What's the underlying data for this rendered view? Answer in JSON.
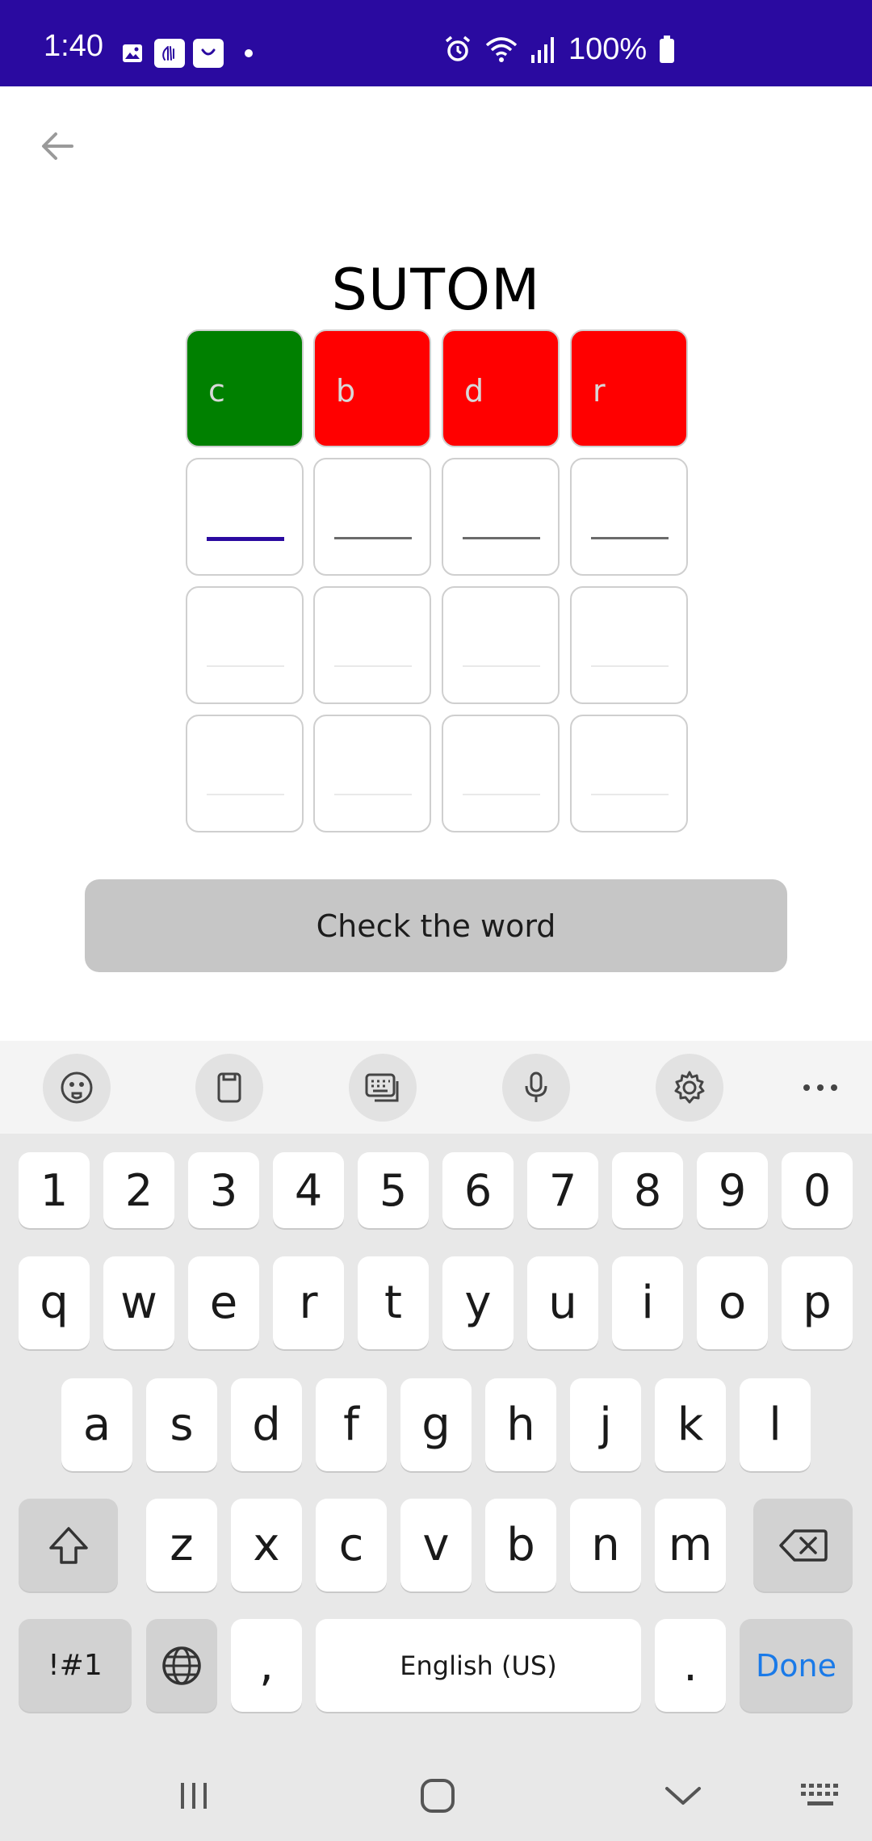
{
  "status_bar": {
    "time": "1:40",
    "battery_percent": "100%",
    "notification_icons": [
      "image-icon",
      "hand-icon",
      "bag-icon",
      "dot-icon"
    ],
    "system_icons": [
      "alarm-icon",
      "wifi-icon",
      "signal-icon",
      "battery-icon"
    ],
    "background": "#2a0aa0"
  },
  "app": {
    "title": "SUTOM",
    "back_icon": "arrow-left-icon",
    "check_button_label": "Check the word",
    "grid": {
      "rows": [
        [
          {
            "letter": "c",
            "state": "correct",
            "color": "#008000"
          },
          {
            "letter": "b",
            "state": "wrong",
            "color": "#ff0000"
          },
          {
            "letter": "d",
            "state": "wrong",
            "color": "#ff0000"
          },
          {
            "letter": "r",
            "state": "wrong",
            "color": "#ff0000"
          }
        ],
        [
          {
            "letter": "",
            "state": "active"
          },
          {
            "letter": "",
            "state": "editable"
          },
          {
            "letter": "",
            "state": "editable"
          },
          {
            "letter": "",
            "state": "editable"
          }
        ],
        [
          {
            "letter": "",
            "state": "disabled"
          },
          {
            "letter": "",
            "state": "disabled"
          },
          {
            "letter": "",
            "state": "disabled"
          },
          {
            "letter": "",
            "state": "disabled"
          }
        ],
        [
          {
            "letter": "",
            "state": "disabled"
          },
          {
            "letter": "",
            "state": "disabled"
          },
          {
            "letter": "",
            "state": "disabled"
          },
          {
            "letter": "",
            "state": "disabled"
          }
        ]
      ]
    }
  },
  "keyboard": {
    "toolbar": [
      "emoji-icon",
      "clipboard-icon",
      "keyboard-mode-icon",
      "microphone-icon",
      "settings-icon",
      "more-icon"
    ],
    "number_row": [
      "1",
      "2",
      "3",
      "4",
      "5",
      "6",
      "7",
      "8",
      "9",
      "0"
    ],
    "row1": [
      "q",
      "w",
      "e",
      "r",
      "t",
      "y",
      "u",
      "i",
      "o",
      "p"
    ],
    "row2": [
      "a",
      "s",
      "d",
      "f",
      "g",
      "h",
      "j",
      "k",
      "l"
    ],
    "row3": [
      "z",
      "x",
      "c",
      "v",
      "b",
      "n",
      "m"
    ],
    "symbols_label": "!#1",
    "comma_label": ",",
    "space_label": "English (US)",
    "period_label": ".",
    "done_label": "Done",
    "done_color": "#1a7ae8"
  },
  "navbar": {
    "buttons": [
      "recents-icon",
      "home-icon",
      "hide-keyboard-icon",
      "keyboard-switch-icon"
    ]
  }
}
